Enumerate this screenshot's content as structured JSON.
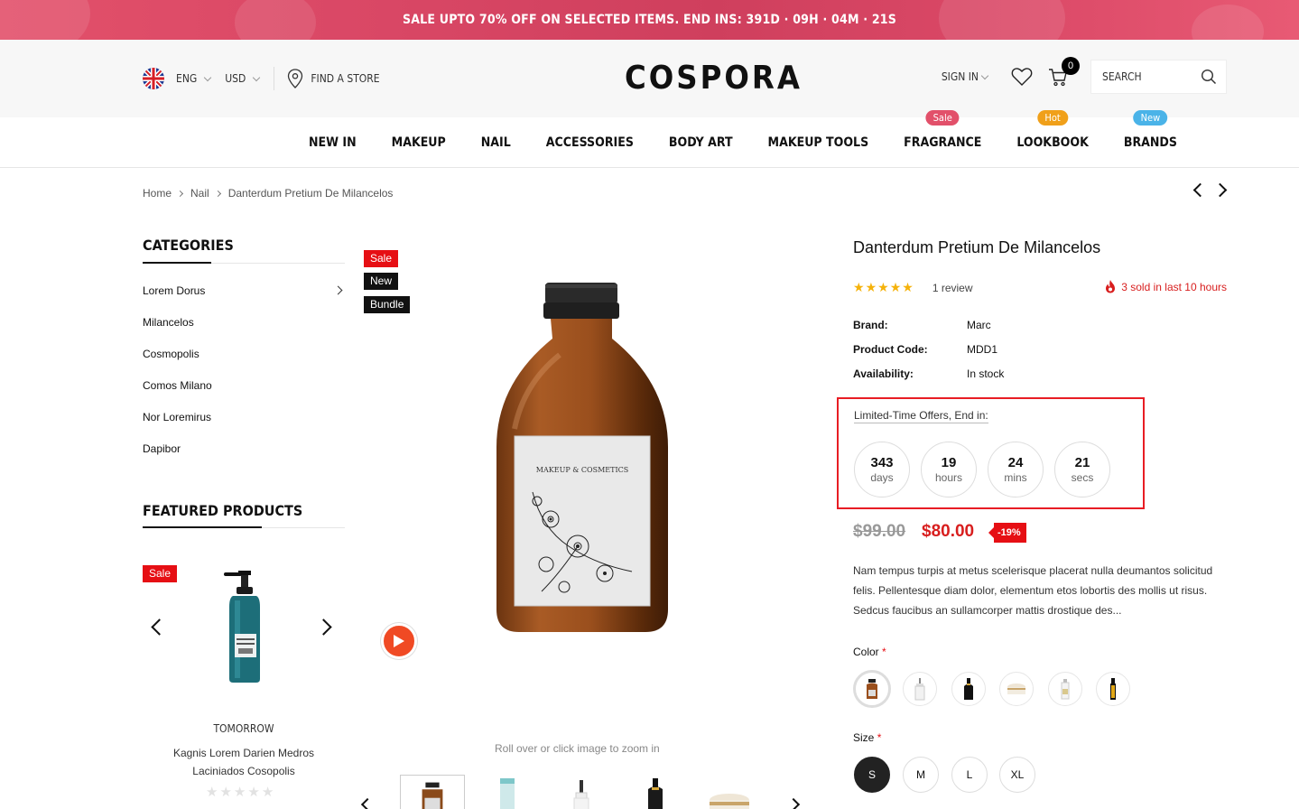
{
  "promo": {
    "text": "SALE UPTO 70% OFF ON SELECTED ITEMS. END INS: 391D · 09H · 04M · 21S"
  },
  "header": {
    "language": "ENG",
    "currency": "USD",
    "find_store": "FIND A STORE",
    "logo": "COSPORA",
    "sign_in": "SIGN IN",
    "cart_count": "0",
    "search_placeholder": "SEARCH"
  },
  "nav": {
    "items": [
      {
        "label": "NEW IN"
      },
      {
        "label": "MAKEUP"
      },
      {
        "label": "NAIL"
      },
      {
        "label": "ACCESSORIES"
      },
      {
        "label": "BODY ART"
      },
      {
        "label": "MAKEUP TOOLS"
      },
      {
        "label": "FRAGRANCE",
        "badge": "Sale",
        "badge_color": "#e2506a"
      },
      {
        "label": "LOOKBOOK",
        "badge": "Hot",
        "badge_color": "#f0a01a"
      },
      {
        "label": "BRANDS",
        "badge": "New",
        "badge_color": "#4ab3e8"
      }
    ]
  },
  "breadcrumb": [
    "Home",
    "Nail",
    "Danterdum Pretium De Milancelos"
  ],
  "sidebar": {
    "categories_title": "CATEGORIES",
    "categories": [
      "Lorem Dorus",
      "Milancelos",
      "Cosmopolis",
      "Comos Milano",
      "Nor Loremirus",
      "Dapibor"
    ],
    "featured_title": "FEATURED PRODUCTS",
    "featured": {
      "badge": "Sale",
      "vendor": "TOMORROW",
      "name": "Kagnis Lorem Darien Medros Laciniados Cosopolis",
      "rating": 0
    }
  },
  "gallery": {
    "badges": [
      "Sale",
      "New",
      "Bundle"
    ],
    "bottle_label": "MAKEUP & COSMETICS",
    "zoom_hint": "Roll over or click image to zoom in"
  },
  "product": {
    "title": "Danterdum Pretium De Milancelos",
    "rating": 5,
    "reviews": "1 review",
    "sold": "3 sold in last 10 hours",
    "brand_label": "Brand:",
    "brand": "Marc",
    "code_label": "Product Code:",
    "code": "MDD1",
    "availability_label": "Availability:",
    "availability": "In stock",
    "offer_label": "Limited-Time Offers, End in:",
    "countdown": [
      {
        "value": "343",
        "unit": "days"
      },
      {
        "value": "19",
        "unit": "hours"
      },
      {
        "value": "24",
        "unit": "mins"
      },
      {
        "value": "21",
        "unit": "secs"
      }
    ],
    "price_old": "$99.00",
    "price_new": "$80.00",
    "discount": "-19%",
    "description": "Nam tempus turpis at metus scelerisque placerat nulla deumantos solicitud felis. Pellentesque diam dolor, elementum etos lobortis des mollis ut risus. Sedcus faucibus an sullamcorper mattis drostique des...",
    "color_label": "Color",
    "size_label": "Size",
    "required_mark": "*",
    "sizes": [
      "S",
      "M",
      "L",
      "XL"
    ],
    "selected_size": "S"
  },
  "colors": {
    "accent_red": "#e60f14",
    "price_red": "#d81e1e",
    "star": "#f5b20a"
  }
}
